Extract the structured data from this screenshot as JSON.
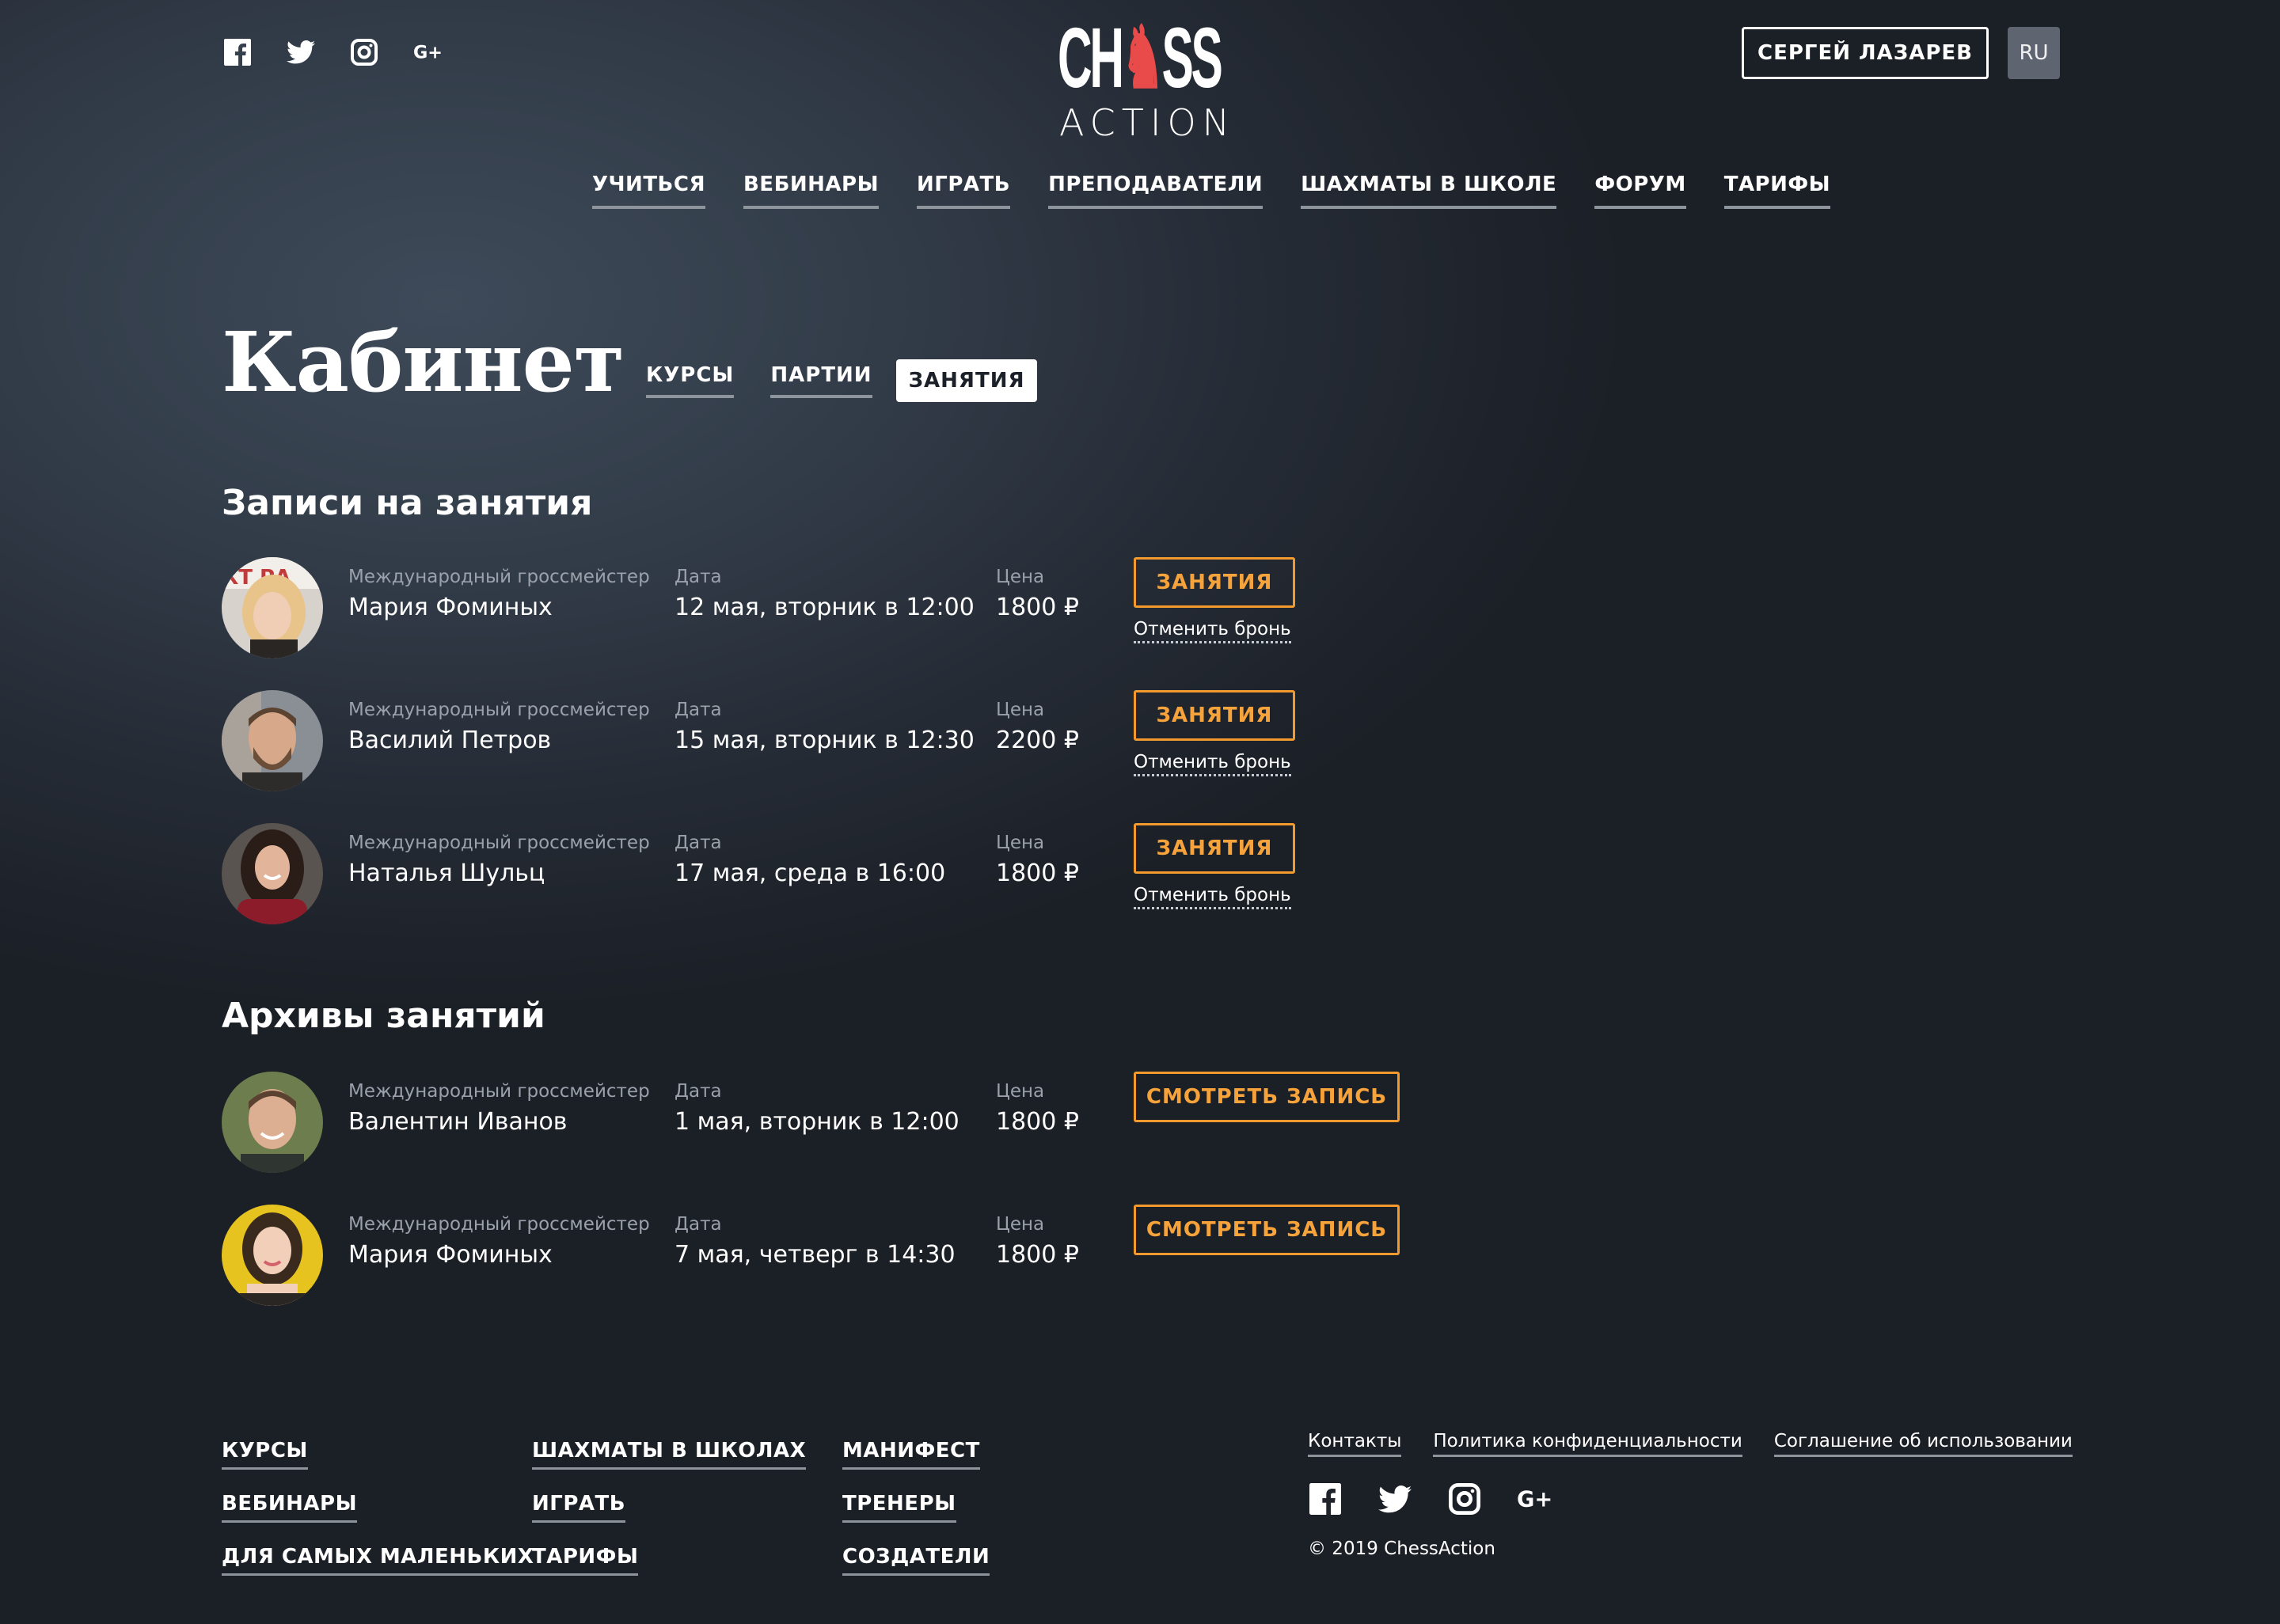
{
  "header": {
    "social": [
      "facebook-icon",
      "twitter-icon",
      "instagram-icon",
      "google-plus-icon"
    ],
    "logo": {
      "top": "CH",
      "knight": "♞",
      "top_end": "SS",
      "bottom": "ACTION"
    },
    "user_name": "СЕРГЕЙ ЛАЗАРЕВ",
    "language": "RU",
    "nav": [
      {
        "label": "УЧИТЬСЯ"
      },
      {
        "label": "ВЕБИНАРЫ"
      },
      {
        "label": "ИГРАТЬ"
      },
      {
        "label": "ПРЕПОДАВАТЕЛИ"
      },
      {
        "label": "ШАХМАТЫ В ШКОЛЕ"
      },
      {
        "label": "ФОРУМ"
      },
      {
        "label": "ТАРИФЫ"
      }
    ]
  },
  "page": {
    "title": "Кабинет",
    "tabs": [
      {
        "label": "КУРСЫ",
        "active": false
      },
      {
        "label": "ПАРТИИ",
        "active": false
      },
      {
        "label": "ЗАНЯТИЯ",
        "active": true
      }
    ]
  },
  "bookings": {
    "title": "Записи на занятия",
    "rows": [
      {
        "role": "Международный гроссмейстер",
        "name": "Мария Фоминых",
        "date_label": "Дата",
        "date": "12 мая, вторник в 12:00",
        "price_label": "Цена",
        "price": "1800 ₽",
        "button": "ЗАНЯТИЯ",
        "cancel": "Отменить бронь"
      },
      {
        "role": "Международный гроссмейстер",
        "name": "Василий Петров",
        "date_label": "Дата",
        "date": "15 мая, вторник в 12:30",
        "price_label": "Цена",
        "price": "2200 ₽",
        "button": "ЗАНЯТИЯ",
        "cancel": "Отменить бронь"
      },
      {
        "role": "Международный гроссмейстер",
        "name": "Наталья Шульц",
        "date_label": "Дата",
        "date": "17 мая, среда в 16:00",
        "price_label": "Цена",
        "price": "1800 ₽",
        "button": "ЗАНЯТИЯ",
        "cancel": "Отменить бронь"
      }
    ]
  },
  "archives": {
    "title": "Архивы занятий",
    "rows": [
      {
        "role": "Международный гроссмейстер",
        "name": "Валентин Иванов",
        "date_label": "Дата",
        "date": "1 мая, вторник в 12:00",
        "price_label": "Цена",
        "price": "1800 ₽",
        "button": "СМОТРЕТЬ ЗАПИСЬ"
      },
      {
        "role": "Международный гроссмейстер",
        "name": "Мария Фоминых",
        "date_label": "Дата",
        "date": "7 мая, четверг в 14:30",
        "price_label": "Цена",
        "price": "1800 ₽",
        "button": "СМОТРЕТЬ ЗАПИСЬ"
      }
    ]
  },
  "footer": {
    "col1": [
      "КУРСЫ",
      "ВЕБИНАРЫ",
      "ДЛЯ САМЫХ МАЛЕНЬКИХ"
    ],
    "col2": [
      "ШАХМАТЫ В ШКОЛАХ",
      "ИГРАТЬ",
      "ТАРИФЫ"
    ],
    "col3": [
      "МАНИФЕСТ",
      "ТРЕНЕРЫ",
      "СОЗДАТЕЛИ"
    ],
    "links": [
      "Контакты",
      "Политика конфиденциальности",
      "Соглашение об использовании"
    ],
    "social": [
      "facebook-icon",
      "twitter-icon",
      "instagram-icon",
      "google-plus-icon"
    ],
    "copyright": "© 2019 ChessAction"
  },
  "colors": {
    "accent": "#f39a2e",
    "logo_knight": "#e94a4a",
    "background_light": "#3e4a59",
    "background_dark": "#1b1f26"
  }
}
